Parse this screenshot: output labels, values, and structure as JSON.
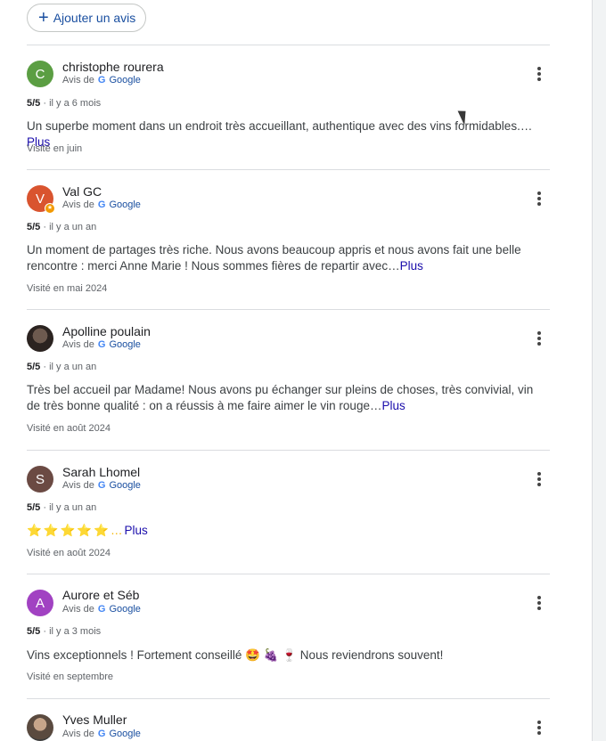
{
  "add_review": {
    "label": "Ajouter un avis"
  },
  "source_prefix": "Avis de",
  "source_name": "Google",
  "more_label": "Plus",
  "reviews": [
    {
      "name": "christophe rourera",
      "initial": "C",
      "avatar_color": "#5b9e43",
      "rating": "5/5",
      "time": "il y a 6 mois",
      "text": "Un superbe moment dans un endroit très accueillant, authentique avec des vins formidables.…",
      "visited": "Visité en juin"
    },
    {
      "name": "Val GC",
      "initial": "V",
      "avatar_color": "#d9542f",
      "rating": "5/5",
      "time": "il y a un an",
      "text": "Un moment de partages très riche. Nous avons beaucoup appris et nous avons fait une belle rencontre : merci Anne Marie ! Nous sommes fières de repartir avec…",
      "visited": "Visité en mai 2024"
    },
    {
      "name": "Apolline poulain",
      "initial": "",
      "avatar_color": "#3a2d28",
      "rating": "5/5",
      "time": "il y a un an",
      "text": "Très bel accueil par Madame! Nous avons pu échanger sur pleins de choses, très convivial, vin de très bonne qualité : on a réussis à me faire aimer le vin rouge…",
      "visited": "Visité en août 2024"
    },
    {
      "name": "Sarah Lhomel",
      "initial": "S",
      "avatar_color": "#6b4a43",
      "rating": "5/5",
      "time": "il y a un an",
      "text": "⭐⭐⭐⭐⭐…",
      "visited": "Visité en août 2024"
    },
    {
      "name": "Aurore et Séb",
      "initial": "A",
      "avatar_color": "#a142c2",
      "rating": "5/5",
      "time": "il y a 3 mois",
      "text": "Vins exceptionnels ! Fortement conseillé 🤩 🍇 🍷 Nous reviendrons souvent!",
      "visited": "Visité en septembre"
    },
    {
      "name": "Yves Muller",
      "initial": "",
      "avatar_color": "#6b6b6b"
    }
  ]
}
